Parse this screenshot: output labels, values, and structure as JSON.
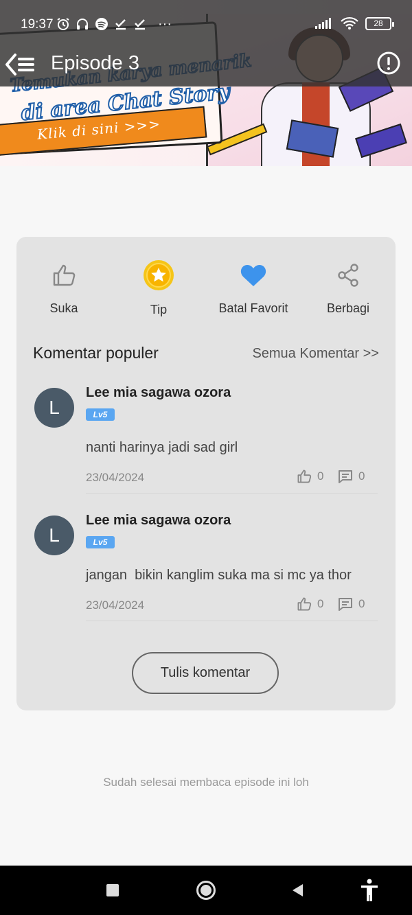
{
  "status_bar": {
    "time": "19:37",
    "battery": "28",
    "more": "···"
  },
  "header": {
    "title": "Episode 3"
  },
  "banner": {
    "line1": "Temukan karya menarik",
    "line2": "di area Chat Story",
    "cta": "Klik di sini >>>"
  },
  "actions": [
    {
      "label": "Suka",
      "icon": "thumbs-up-icon"
    },
    {
      "label": "Tip",
      "icon": "star-coin-icon"
    },
    {
      "label": "Batal Favorit",
      "icon": "heart-icon"
    },
    {
      "label": "Berbagi",
      "icon": "share-icon"
    }
  ],
  "comments_section": {
    "title": "Komentar populer",
    "see_all": "Semua Komentar >>"
  },
  "comments": [
    {
      "avatar_letter": "L",
      "user": "Lee mia sagawa ozora",
      "level": "Lv5",
      "text": "nanti harinya jadi sad girl",
      "date": "23/04/2024",
      "likes": "0",
      "replies": "0"
    },
    {
      "avatar_letter": "L",
      "user": "Lee mia sagawa ozora",
      "level": "Lv5",
      "text": "jangan  bikin kanglim suka ma si mc ya thor",
      "date": "23/04/2024",
      "likes": "0",
      "replies": "0"
    }
  ],
  "write_comment": "Tulis komentar",
  "finish_note": "Sudah selesai membaca episode ini loh",
  "colors": {
    "tip": "#f5c518",
    "heart": "#3d93ec",
    "level_badge": "#5aa6f1",
    "avatar": "#4a5a68"
  }
}
